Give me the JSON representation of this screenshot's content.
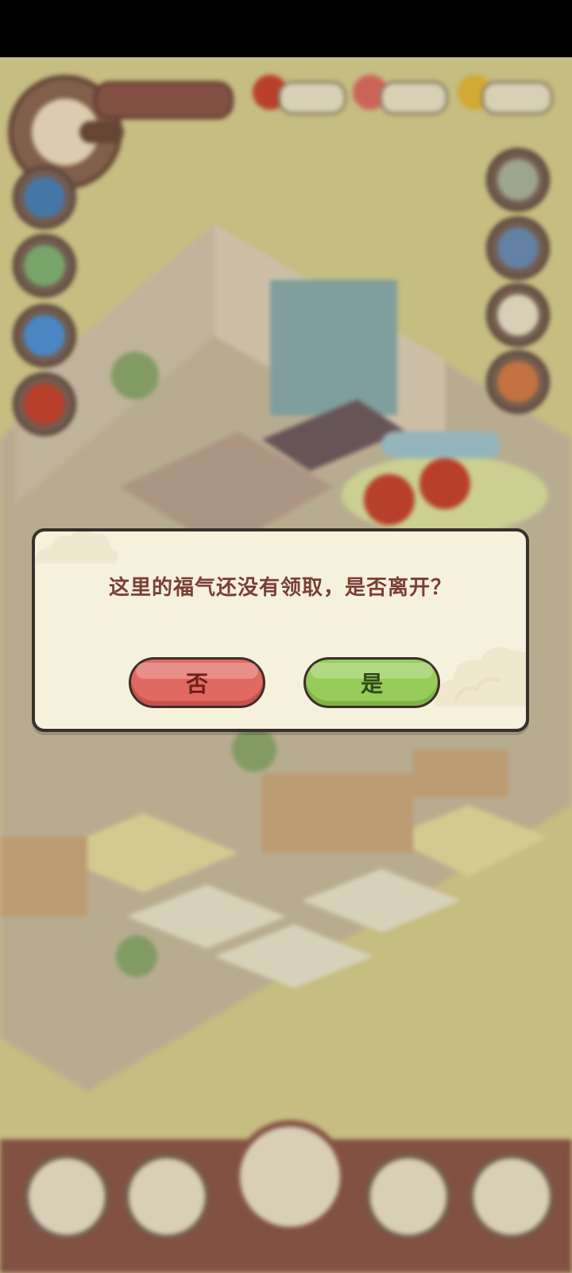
{
  "dialog": {
    "message": "这里的福气还没有领取，是否离开？",
    "no_label": "否",
    "yes_label": "是"
  },
  "colors": {
    "dialog_bg": "#f6f1dc",
    "dialog_border": "#3b2f2a",
    "message_text": "#7a3f35",
    "no_button": "#e06a62",
    "yes_button": "#97cc5a",
    "game_background": "#d3c98a"
  },
  "icons": {
    "avatar": "player-avatar-icon",
    "resource_1": "red-envelope-icon",
    "resource_2": "ticket-icon",
    "resource_3": "gold-ingot-icon"
  }
}
